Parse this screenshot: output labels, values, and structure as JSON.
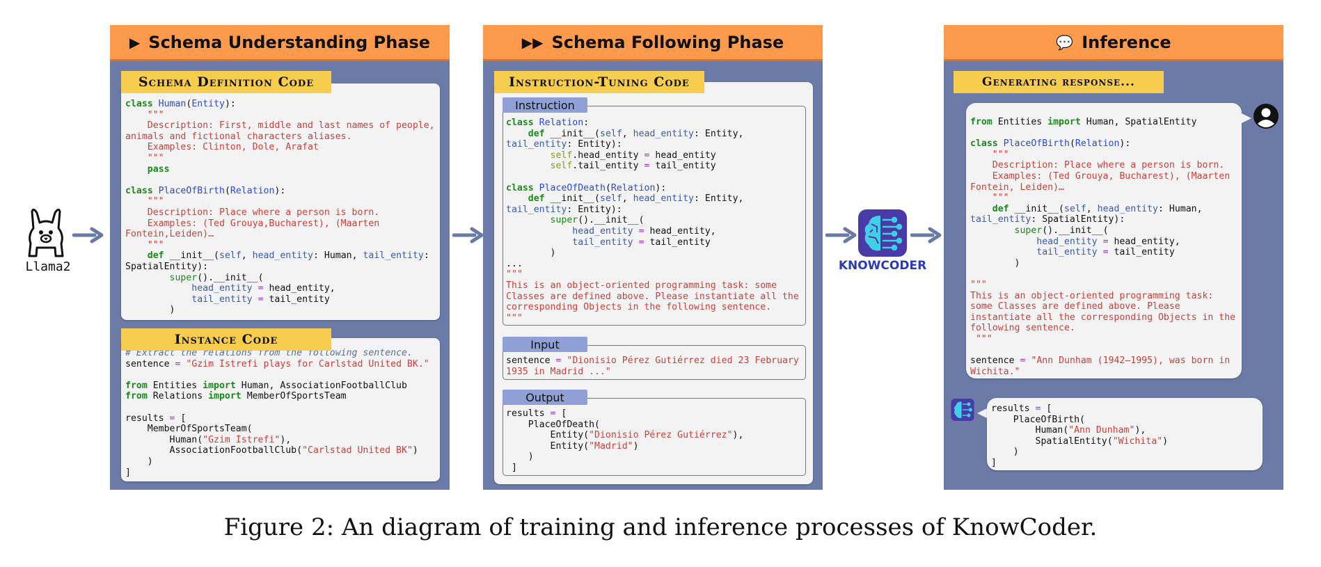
{
  "llama": {
    "label": "Llama2"
  },
  "knowcoder": {
    "label": "KNOWCODER"
  },
  "panel1": {
    "title": "Schema Understanding Phase",
    "definition_tag": "Schema Definition Code",
    "instance_tag": "Instance Code"
  },
  "panel2": {
    "title": "Schema Following Phase",
    "tuning_tag": "Instruction-Tuning Code",
    "instruction_label": "Instruction",
    "input_label": "Input",
    "output_label": "Output"
  },
  "panel3": {
    "title": "Inference",
    "generating_tag": "Generating response..."
  },
  "code": {
    "schema_definition": [
      [
        [
          "kw",
          "class"
        ],
        [
          "t",
          " "
        ],
        [
          "cls",
          "Human"
        ],
        [
          "t",
          "("
        ],
        [
          "cls",
          "Entity"
        ],
        [
          "t",
          "):"
        ]
      ],
      [
        [
          "str",
          "    \"\"\""
        ]
      ],
      [
        [
          "str",
          "    Description: First, middle and last names of people,"
        ]
      ],
      [
        [
          "str",
          "animals and fictional characters aliases."
        ]
      ],
      [
        [
          "str",
          "    Examples: Clinton, Dole, Arafat"
        ]
      ],
      [
        [
          "str",
          "    \"\"\""
        ]
      ],
      [
        [
          "t",
          "    "
        ],
        [
          "kw",
          "pass"
        ]
      ],
      [
        [
          "t",
          ""
        ]
      ],
      [
        [
          "kw",
          "class"
        ],
        [
          "t",
          " "
        ],
        [
          "cls",
          "PlaceOfBirth"
        ],
        [
          "t",
          "("
        ],
        [
          "cls",
          "Relation"
        ],
        [
          "t",
          "):"
        ]
      ],
      [
        [
          "str",
          "    \"\"\""
        ]
      ],
      [
        [
          "str",
          "    Description: Place where a person is born."
        ]
      ],
      [
        [
          "str",
          "    Examples: (Ted Grouya,Bucharest), (Maarten"
        ]
      ],
      [
        [
          "str",
          "Fontein,Leiden)…"
        ]
      ],
      [
        [
          "str",
          "    \"\"\""
        ]
      ],
      [
        [
          "t",
          "    "
        ],
        [
          "kw",
          "def"
        ],
        [
          "t",
          " __init__("
        ],
        [
          "prm",
          "self"
        ],
        [
          "t",
          ", "
        ],
        [
          "prm",
          "head_entity"
        ],
        [
          "t",
          ": Human, "
        ],
        [
          "prm",
          "tail_entity"
        ],
        [
          "t",
          ":"
        ]
      ],
      [
        [
          "t",
          "SpatialEntity):"
        ]
      ],
      [
        [
          "t",
          "        "
        ],
        [
          "kw2",
          "super"
        ],
        [
          "t",
          "().__init__("
        ]
      ],
      [
        [
          "t",
          "            "
        ],
        [
          "prm",
          "head_entity"
        ],
        [
          "t",
          " "
        ],
        [
          "op",
          "="
        ],
        [
          "t",
          " head_entity,"
        ]
      ],
      [
        [
          "t",
          "            "
        ],
        [
          "prm",
          "tail_entity"
        ],
        [
          "t",
          " "
        ],
        [
          "op",
          "="
        ],
        [
          "t",
          " tail_entity"
        ]
      ],
      [
        [
          "t",
          "        )"
        ]
      ]
    ],
    "instance": [
      [
        [
          "cm",
          "# Extract the relations from the following sentence."
        ]
      ],
      [
        [
          "t",
          "sentence "
        ],
        [
          "op",
          "="
        ],
        [
          "t",
          " "
        ],
        [
          "str",
          "\"Gzim Istrefi plays for Carlstad United BK.\""
        ]
      ],
      [
        [
          "t",
          ""
        ]
      ],
      [
        [
          "kw",
          "from"
        ],
        [
          "t",
          " Entities "
        ],
        [
          "kw",
          "import"
        ],
        [
          "t",
          " Human, AssociationFootballClub"
        ]
      ],
      [
        [
          "kw",
          "from"
        ],
        [
          "t",
          " Relations "
        ],
        [
          "kw",
          "import"
        ],
        [
          "t",
          " MemberOfSportsTeam"
        ]
      ],
      [
        [
          "t",
          ""
        ]
      ],
      [
        [
          "t",
          "results "
        ],
        [
          "op",
          "="
        ],
        [
          "t",
          " ["
        ]
      ],
      [
        [
          "t",
          "    MemberOfSportsTeam("
        ]
      ],
      [
        [
          "t",
          "        Human("
        ],
        [
          "str",
          "\"Gzim Istrefi\""
        ],
        [
          "t",
          "),"
        ]
      ],
      [
        [
          "t",
          "        AssociationFootballClub("
        ],
        [
          "str",
          "\"Carlstad United BK\""
        ],
        [
          "t",
          ")"
        ]
      ],
      [
        [
          "t",
          "    )"
        ]
      ],
      [
        [
          "t",
          "]"
        ]
      ]
    ],
    "instruction": [
      [
        [
          "kw",
          "class"
        ],
        [
          "t",
          " "
        ],
        [
          "cls",
          "Relation"
        ],
        [
          "t",
          ":"
        ]
      ],
      [
        [
          "t",
          "    "
        ],
        [
          "kw",
          "def"
        ],
        [
          "t",
          " __init__("
        ],
        [
          "prm",
          "self"
        ],
        [
          "t",
          ", "
        ],
        [
          "prm",
          "head_entity"
        ],
        [
          "t",
          ": Entity,"
        ]
      ],
      [
        [
          "prm",
          "tail_entity"
        ],
        [
          "t",
          ": Entity):"
        ]
      ],
      [
        [
          "t",
          "        "
        ],
        [
          "slf",
          "self"
        ],
        [
          "t",
          ".head_entity "
        ],
        [
          "op",
          "="
        ],
        [
          "t",
          " head_entity"
        ]
      ],
      [
        [
          "t",
          "        "
        ],
        [
          "slf",
          "self"
        ],
        [
          "t",
          ".tail_entity "
        ],
        [
          "op",
          "="
        ],
        [
          "t",
          " tail_entity"
        ]
      ],
      [
        [
          "t",
          ""
        ]
      ],
      [
        [
          "kw",
          "class"
        ],
        [
          "t",
          " "
        ],
        [
          "cls",
          "PlaceOfDeath"
        ],
        [
          "t",
          "("
        ],
        [
          "cls",
          "Relation"
        ],
        [
          "t",
          "):"
        ]
      ],
      [
        [
          "t",
          "    "
        ],
        [
          "kw",
          "def"
        ],
        [
          "t",
          " __init__("
        ],
        [
          "prm",
          "self"
        ],
        [
          "t",
          ", "
        ],
        [
          "prm",
          "head_entity"
        ],
        [
          "t",
          ": Entity,"
        ]
      ],
      [
        [
          "prm",
          "tail_entity"
        ],
        [
          "t",
          ": Entity):"
        ]
      ],
      [
        [
          "t",
          "        "
        ],
        [
          "kw2",
          "super"
        ],
        [
          "t",
          "().__init__("
        ]
      ],
      [
        [
          "t",
          "            "
        ],
        [
          "prm",
          "head_entity"
        ],
        [
          "t",
          " "
        ],
        [
          "op",
          "="
        ],
        [
          "t",
          " head_entity,"
        ]
      ],
      [
        [
          "t",
          "            "
        ],
        [
          "prm",
          "tail_entity"
        ],
        [
          "t",
          " "
        ],
        [
          "op",
          "="
        ],
        [
          "t",
          " tail_entity"
        ]
      ],
      [
        [
          "t",
          "        )"
        ]
      ],
      [
        [
          "t",
          "..."
        ]
      ],
      [
        [
          "str",
          "\"\"\""
        ]
      ],
      [
        [
          "str",
          "This is an object-oriented programming task: some"
        ]
      ],
      [
        [
          "str",
          "Classes are defined above. Please instantiate all the"
        ]
      ],
      [
        [
          "str",
          "corresponding Objects in the following sentence."
        ]
      ],
      [
        [
          "str",
          "\"\"\""
        ]
      ]
    ],
    "input": [
      [
        [
          "t",
          "sentence "
        ],
        [
          "op",
          "="
        ],
        [
          "t",
          " "
        ],
        [
          "str",
          "\"Dionisio Pérez Gutiérrez died 23 February"
        ]
      ],
      [
        [
          "str",
          "1935 in Madrid ...\""
        ]
      ]
    ],
    "output": [
      [
        [
          "t",
          "results "
        ],
        [
          "op",
          "="
        ],
        [
          "t",
          " ["
        ]
      ],
      [
        [
          "t",
          "    PlaceOfDeath("
        ]
      ],
      [
        [
          "t",
          "        Entity("
        ],
        [
          "str",
          "\"Dionisio Pérez Gutiérrez\""
        ],
        [
          "t",
          "),"
        ]
      ],
      [
        [
          "t",
          "        Entity("
        ],
        [
          "str",
          "\"Madrid\""
        ],
        [
          "t",
          ")"
        ]
      ],
      [
        [
          "t",
          "    )"
        ]
      ],
      [
        [
          "t",
          " ]"
        ]
      ]
    ],
    "inference_prompt": [
      [
        [
          "kw",
          "from"
        ],
        [
          "t",
          " Entities "
        ],
        [
          "kw",
          "import"
        ],
        [
          "t",
          " Human, SpatialEntity"
        ]
      ],
      [
        [
          "t",
          ""
        ]
      ],
      [
        [
          "kw",
          "class"
        ],
        [
          "t",
          " "
        ],
        [
          "cls",
          "PlaceOfBirth"
        ],
        [
          "t",
          "("
        ],
        [
          "cls",
          "Relation"
        ],
        [
          "t",
          "):"
        ]
      ],
      [
        [
          "str",
          "    \"\"\""
        ]
      ],
      [
        [
          "str",
          "    Description: Place where a person is born."
        ]
      ],
      [
        [
          "str",
          "    Examples: (Ted Grouya, Bucharest), (Maarten"
        ]
      ],
      [
        [
          "str",
          "Fontein, Leiden)…"
        ]
      ],
      [
        [
          "str",
          "    \"\"\""
        ]
      ],
      [
        [
          "t",
          "    "
        ],
        [
          "kw",
          "def"
        ],
        [
          "t",
          " __init__("
        ],
        [
          "prm",
          "self"
        ],
        [
          "t",
          ", "
        ],
        [
          "prm",
          "head_entity"
        ],
        [
          "t",
          ": Human,"
        ]
      ],
      [
        [
          "prm",
          "tail_entity"
        ],
        [
          "t",
          ": SpatialEntity):"
        ]
      ],
      [
        [
          "t",
          "        "
        ],
        [
          "kw2",
          "super"
        ],
        [
          "t",
          "().__init__("
        ]
      ],
      [
        [
          "t",
          "            "
        ],
        [
          "prm",
          "head_entity"
        ],
        [
          "t",
          " "
        ],
        [
          "op",
          "="
        ],
        [
          "t",
          " head_entity,"
        ]
      ],
      [
        [
          "t",
          "            "
        ],
        [
          "prm",
          "tail_entity"
        ],
        [
          "t",
          " "
        ],
        [
          "op",
          "="
        ],
        [
          "t",
          " tail_entity"
        ]
      ],
      [
        [
          "t",
          "        )"
        ]
      ],
      [
        [
          "t",
          ""
        ]
      ],
      [
        [
          "str",
          "\"\"\""
        ]
      ],
      [
        [
          "str",
          "This is an object-oriented programming task:"
        ]
      ],
      [
        [
          "str",
          "some Classes are defined above. Please"
        ]
      ],
      [
        [
          "str",
          "instantiate all the corresponding Objects in the"
        ]
      ],
      [
        [
          "str",
          "following sentence."
        ]
      ],
      [
        [
          "str",
          " \"\"\""
        ]
      ],
      [
        [
          "t",
          ""
        ]
      ],
      [
        [
          "t",
          "sentence "
        ],
        [
          "op",
          "="
        ],
        [
          "t",
          " "
        ],
        [
          "str",
          "\"Ann Dunham (1942–1995), was born in"
        ]
      ],
      [
        [
          "str",
          "Wichita.\""
        ]
      ]
    ],
    "inference_result": [
      [
        [
          "t",
          "results "
        ],
        [
          "op",
          "="
        ],
        [
          "t",
          " ["
        ]
      ],
      [
        [
          "t",
          "    PlaceOfBirth("
        ]
      ],
      [
        [
          "t",
          "        Human("
        ],
        [
          "str",
          "\"Ann Dunham\""
        ],
        [
          "t",
          "),"
        ]
      ],
      [
        [
          "t",
          "        SpatialEntity("
        ],
        [
          "str",
          "\"Wichita\""
        ],
        [
          "t",
          ")"
        ]
      ],
      [
        [
          "t",
          "    )"
        ]
      ],
      [
        [
          "t",
          "]"
        ]
      ]
    ]
  },
  "caption": "Figure 2: An diagram of training and inference processes of KnowCoder.",
  "colors": {
    "panel_bg": "#6b7aa6",
    "header_orange": "#fe9a4b",
    "tag_yellow": "#f6cd4e",
    "label_blue": "#8ea0d6",
    "arrow": "#6a7aa6",
    "keyword": "#198a1a",
    "class_name": "#2a4ad0",
    "string": "#c8403a"
  },
  "icons": {
    "llama": "llama-icon",
    "knowcoder": "brain-circuit-icon",
    "phase1": "play-icon",
    "phase2": "fast-forward-icon",
    "phase3": "chat-bubbles-icon",
    "user": "user-avatar-icon"
  }
}
